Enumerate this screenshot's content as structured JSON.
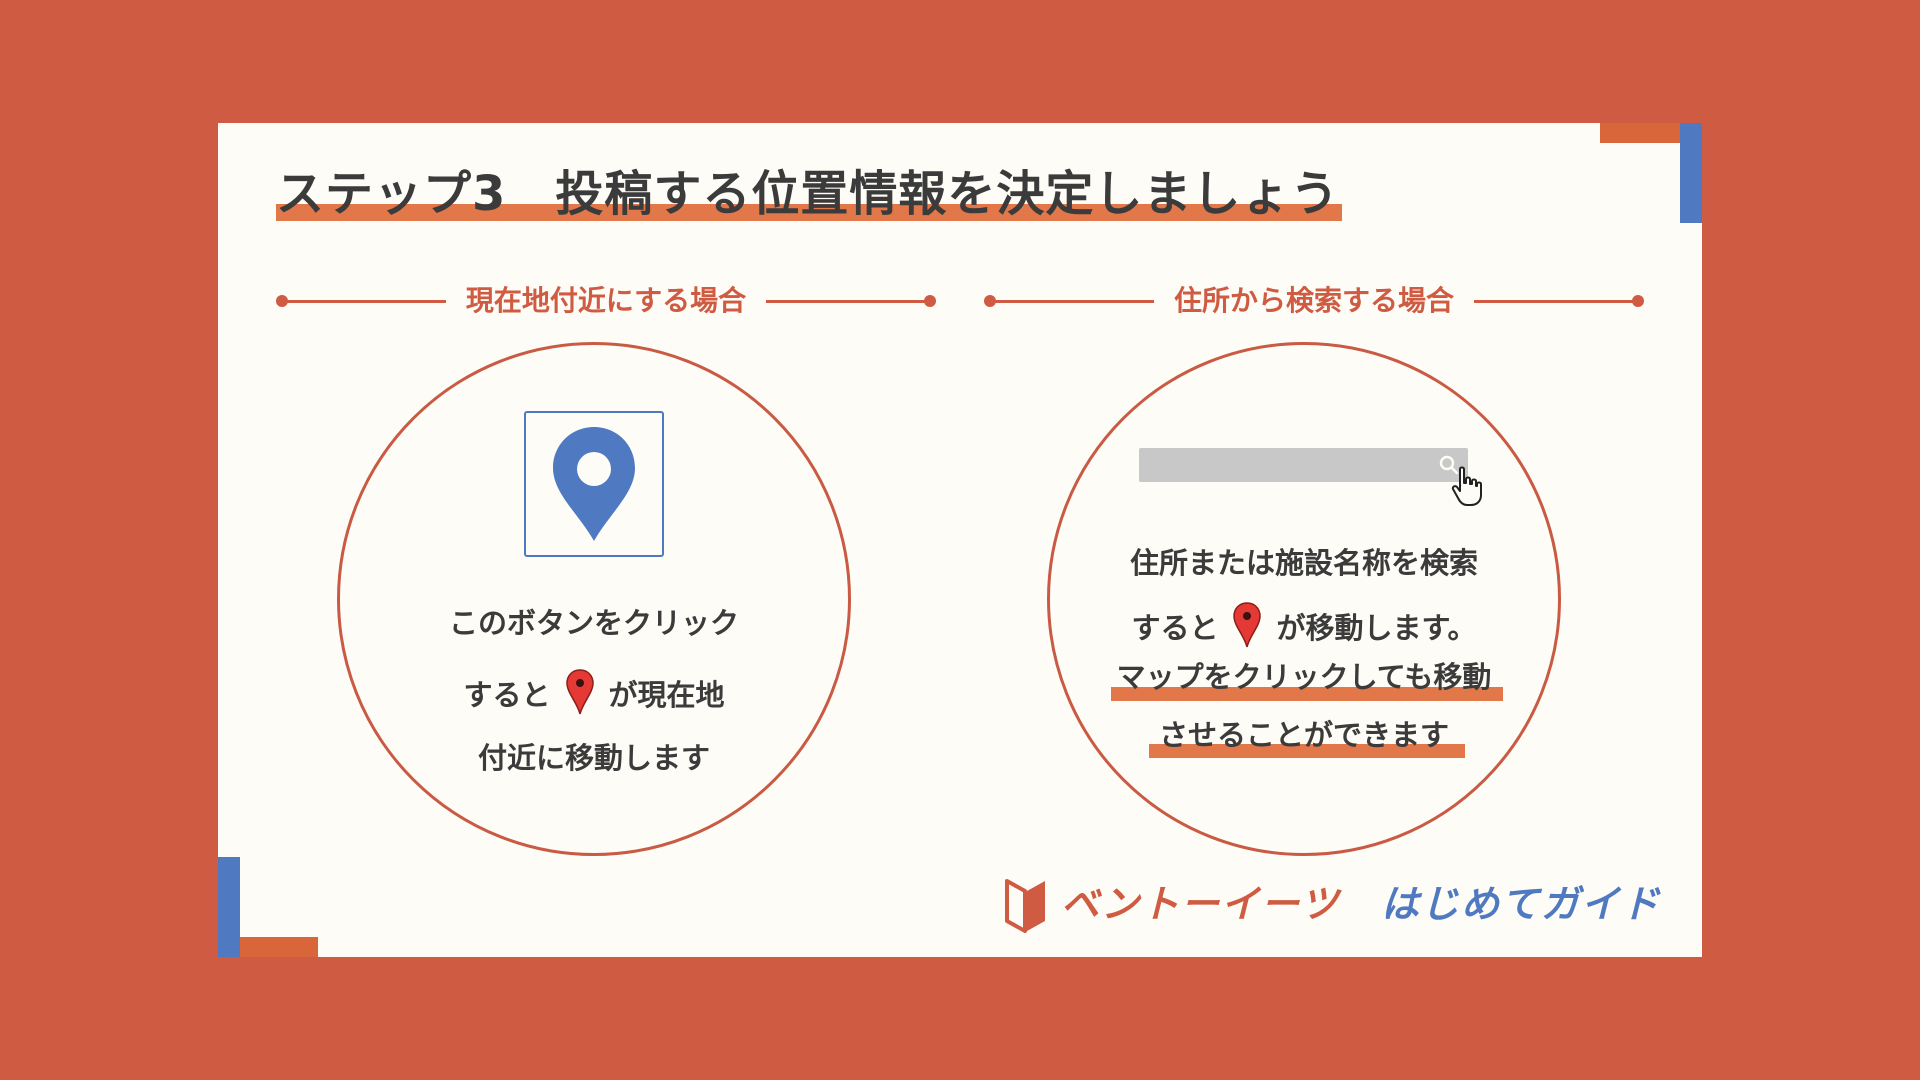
{
  "slide": {
    "title": "ステップ3　投稿する位置情報を決定しましょう"
  },
  "left": {
    "header": "現在地付近にする場合",
    "line1": "このボタンをクリック",
    "line2_before": "すると",
    "line2_after": "が現在地",
    "line3": "付近に移動します"
  },
  "right": {
    "header": "住所から検索する場合",
    "line1": "住所または施設名称を検索",
    "line2_before": "すると",
    "line2_after": "が移動します。",
    "line3": "マップをクリックしても移動",
    "line4": "させることができます"
  },
  "logo": {
    "brand": "ベントーイーツ",
    "guide": "はじめてガイド"
  },
  "colors": {
    "background": "#cf5b42",
    "accent_orange": "#e2784a",
    "accent_blue": "#4f79c0",
    "text_dark": "#3b3b3b"
  }
}
